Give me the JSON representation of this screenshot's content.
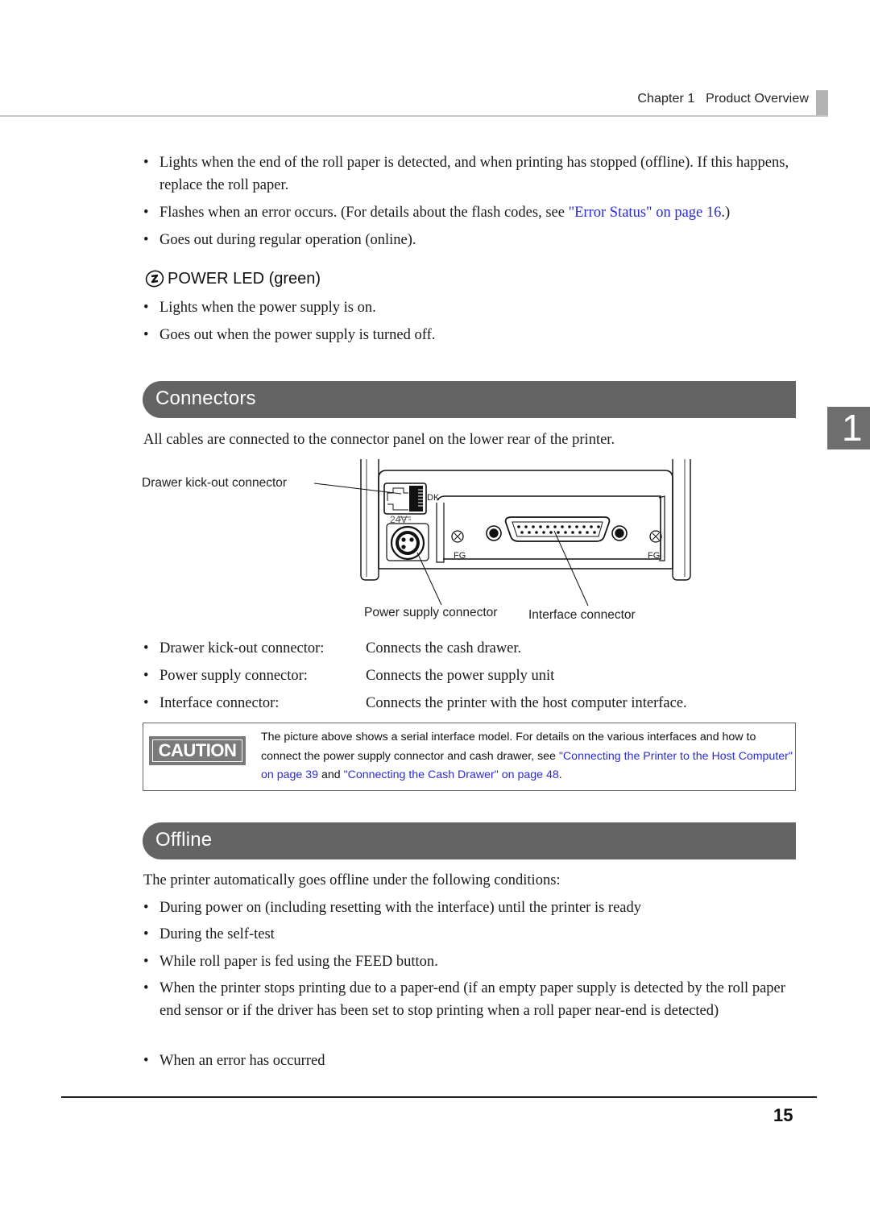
{
  "header": {
    "chapter": "Chapter 1",
    "title": "Product Overview"
  },
  "paper_led_bullets": [
    {
      "text": "Lights when the end of the roll paper is detected, and when printing has stopped (offline). If this happens, replace the roll paper."
    },
    {
      "text_before": "Flashes when an error occurs. (For details about the flash codes, see ",
      "link": "\"Error Status\" on page 16",
      "text_after": ".)"
    },
    {
      "text": "Goes out during regular operation (online)."
    }
  ],
  "power_led": {
    "icon": "power-led-icon",
    "heading": "POWER LED (green)",
    "bullets": [
      "Lights when the power supply is on.",
      "Goes out when the power supply is turned off."
    ]
  },
  "chapter_tab": "1",
  "connectors": {
    "title": "Connectors",
    "intro": "All cables are connected to the connector panel on the lower rear of the printer.",
    "figure": {
      "callouts": {
        "drawer": "Drawer kick-out connector",
        "power": "Power supply connector",
        "interface": "Interface connector"
      },
      "panel_labels": {
        "dk": "DK",
        "voltage": "24V",
        "fg_left": "FG",
        "fg_right": "FG"
      }
    },
    "list": [
      {
        "name": "Drawer kick-out connector:",
        "desc": "Connects the cash drawer."
      },
      {
        "name": "Power supply connector:",
        "desc": "Connects the power supply unit"
      },
      {
        "name": "Interface connector:",
        "desc": "Connects the printer with the host computer interface."
      }
    ],
    "caution": {
      "badge": "CAUTION",
      "text_1": "The picture above shows a serial interface model. For details on the various interfaces and how to connect the power supply connector and cash drawer, see ",
      "link_1": "\"Connecting the Printer to the Host Computer\" on page 39",
      "text_2": " and ",
      "link_2": "\"Connecting the Cash Drawer\" on page 48",
      "text_3": "."
    }
  },
  "offline": {
    "title": "Offline",
    "intro": "The printer automatically goes offline under the following conditions:",
    "bullets": [
      "During power on (including resetting with the interface) until the printer is ready",
      "During the self-test",
      "While roll paper is fed using the FEED button.",
      "When the printer stops printing due to a paper-end (if an empty paper supply is detected by the roll paper end sensor or if the driver has been set to stop printing when a roll paper near-end is detected)",
      "When an error has occurred"
    ]
  },
  "footer": {
    "page_number": "15"
  }
}
